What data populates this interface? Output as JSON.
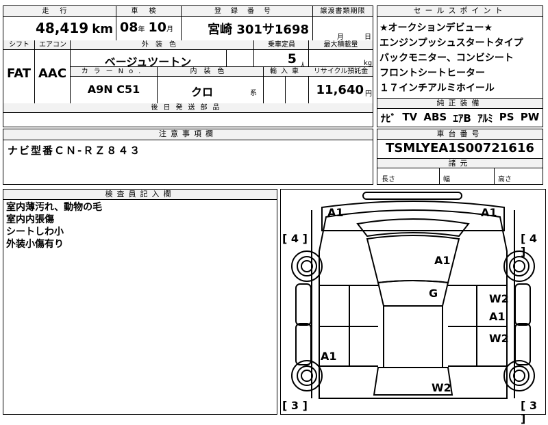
{
  "top_table": {
    "headers": {
      "mileage": "走行",
      "inspection": "車検",
      "registration": "登録番号",
      "transfer_deadline": "譲渡書類期限"
    },
    "mileage": "48,419",
    "mileage_unit": "km",
    "inspection_year": "08",
    "inspection_year_unit": "年",
    "inspection_month": "10",
    "inspection_month_unit": "月",
    "registration": "宮崎 301サ1698",
    "deadline_month_unit": "月",
    "deadline_day_unit": "日",
    "row2_headers": {
      "shift": "シフト",
      "aircon": "エアコン",
      "exterior_color": "外装色",
      "capacity": "乗車定員",
      "max_load": "最大積載量"
    },
    "shift": "FAT",
    "aircon": "AAC",
    "exterior_color": "ベージュツートン",
    "capacity": "5",
    "capacity_unit": "人",
    "max_load_unit": "kg",
    "row3_headers": {
      "color_no": "カラーNo.",
      "interior_color": "内装色",
      "import": "輸入車",
      "recycle": "リサイクル預託金"
    },
    "color_no": "A9N C51",
    "interior_color": "クロ",
    "interior_suffix": "系",
    "recycle": "11,640",
    "recycle_unit": "円",
    "later_parts_header": "後日発送部品"
  },
  "sales_points": {
    "header": "セールスポイント",
    "items": [
      "★オークションデビュー★",
      "エンジンプッシュスタートタイプ",
      "バックモニター、コンビシート",
      "フロントシートヒーター",
      "１７インチアルミホイール"
    ],
    "genuine_header": "純正装備",
    "genuine_items": [
      "ﾅﾋﾞ",
      "TV",
      "ABS",
      "ｴｱB",
      "ｱﾙﾐ",
      "PS",
      "PW"
    ]
  },
  "notes": {
    "header": "注意事項欄",
    "text": "ナビ型番ＣＮ-ＲＺ８４３"
  },
  "chassis": {
    "header": "車台番号",
    "value": "TSMLYEA1S00721616",
    "dims_header": "諸元",
    "length": "長さ",
    "width": "幅",
    "height": "高さ"
  },
  "inspector": {
    "header": "検査員記入欄",
    "lines": [
      "室内薄汚れ、動物の毛",
      "室内内張傷",
      "シートしわ小",
      "外装小傷有り"
    ]
  },
  "diagram": {
    "marks": {
      "fl_corner": "A1",
      "fr_corner": "A1",
      "tire_fl": "4",
      "tire_fr": "4",
      "hood": "A1",
      "roof": "G",
      "r_door1": "W2",
      "r_door1b": "A1",
      "r_door2": "W2",
      "l_door2": "A1",
      "trunk": "W2",
      "tire_rl": "3",
      "tire_rr": "3"
    }
  }
}
